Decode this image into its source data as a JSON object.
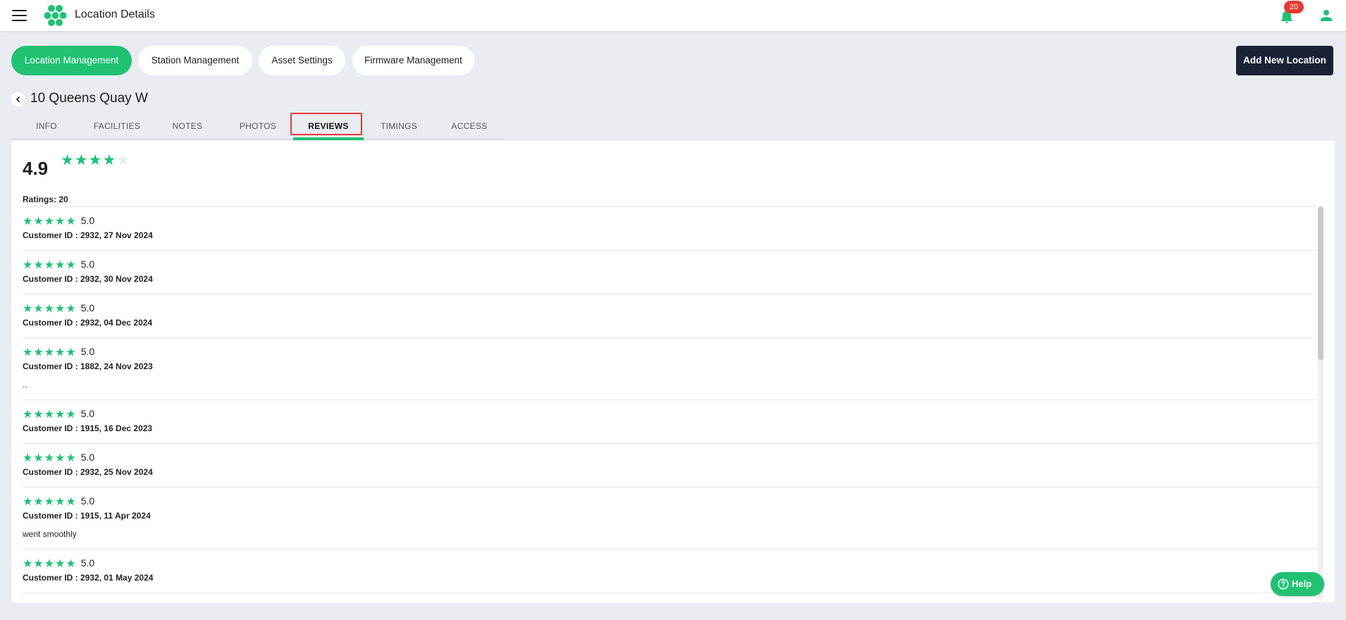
{
  "header": {
    "title": "Location Details",
    "notification_count": "20"
  },
  "nav": {
    "pills": [
      {
        "label": "Location Management",
        "active": true
      },
      {
        "label": "Station Management",
        "active": false
      },
      {
        "label": "Asset Settings",
        "active": false
      },
      {
        "label": "Firmware Management",
        "active": false
      }
    ],
    "add_button": "Add New Location"
  },
  "page": {
    "title": "10 Queens Quay W"
  },
  "tabs": [
    {
      "label": "INFO"
    },
    {
      "label": "FACILITIES"
    },
    {
      "label": "NOTES"
    },
    {
      "label": "PHOTOS"
    },
    {
      "label": "REVIEWS",
      "active": true
    },
    {
      "label": "TIMINGS"
    },
    {
      "label": "ACCESS"
    }
  ],
  "summary": {
    "average": "4.9",
    "average_stars": 4.9,
    "ratings_label": "Ratings: 20"
  },
  "reviews": [
    {
      "stars": 5,
      "score": "5.0",
      "meta": "Customer ID : 2932, 27 Nov 2024",
      "comment": ""
    },
    {
      "stars": 5,
      "score": "5.0",
      "meta": "Customer ID : 2932, 30 Nov 2024",
      "comment": ""
    },
    {
      "stars": 5,
      "score": "5.0",
      "meta": "Customer ID : 2932, 04 Dec 2024",
      "comment": ""
    },
    {
      "stars": 5,
      "score": "5.0",
      "meta": "Customer ID : 1882, 24 Nov 2023",
      "comment": ".."
    },
    {
      "stars": 5,
      "score": "5.0",
      "meta": "Customer ID : 1915, 16 Dec 2023",
      "comment": ""
    },
    {
      "stars": 5,
      "score": "5.0",
      "meta": "Customer ID : 2932, 25 Nov 2024",
      "comment": ""
    },
    {
      "stars": 5,
      "score": "5.0",
      "meta": "Customer ID : 1915, 11 Apr 2024",
      "comment": "went smoothly"
    },
    {
      "stars": 5,
      "score": "5.0",
      "meta": "Customer ID : 2932, 01 May 2024",
      "comment": ""
    }
  ],
  "help": {
    "label": "Help"
  },
  "colors": {
    "accent": "#20c173",
    "dark_button": "#1c2236",
    "badge": "#e53935",
    "highlight": "#e53935"
  },
  "icons": [
    "menu-icon",
    "logo-icon",
    "bell-icon",
    "user-icon",
    "chevron-left-icon",
    "star-icon",
    "help-circle-icon"
  ]
}
